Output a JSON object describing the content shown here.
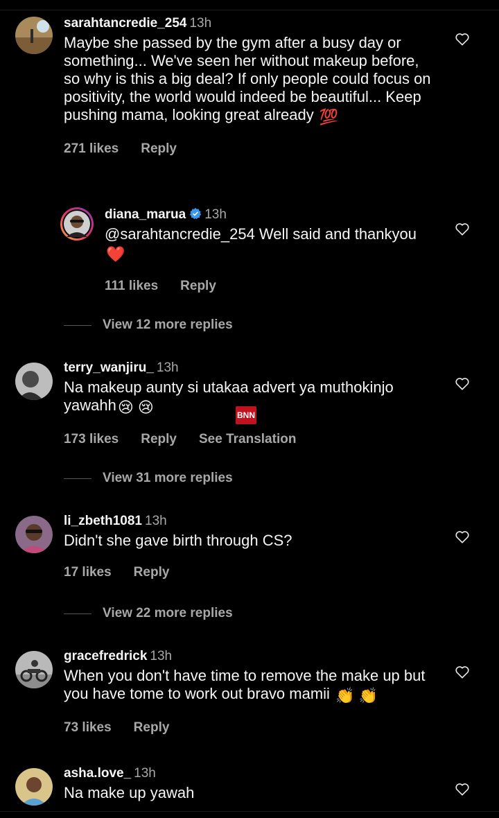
{
  "comments": [
    {
      "username": "sarahtancredie_254",
      "time": "13h",
      "text": "Maybe she passed by the gym after a busy day or something... We've seen her without makeup before, so why is this a big deal? If only people could focus on positivity, the world would indeed be beautiful... Keep pushing mama, looking great already",
      "emoji": "💯",
      "likes": "271 likes",
      "reply_label": "Reply"
    },
    {
      "username": "diana_marua",
      "time": "13h",
      "text": "@sarahtancredie_254 Well said and thankyou",
      "emoji": "❤️",
      "likes": "111 likes",
      "reply_label": "Reply",
      "view_more": "View 12 more replies"
    },
    {
      "username": "terry_wanjiru_",
      "time": "13h",
      "text": "Na makeup aunty si utakaa advert ya muthokinjo yawahh",
      "emoji": "😢 😢",
      "likes": "173 likes",
      "reply_label": "Reply",
      "translation_label": "See Translation",
      "view_more": "View 31 more replies"
    },
    {
      "username": "li_zbeth1081",
      "time": "13h",
      "text": "Didn't she gave birth through CS?",
      "likes": "17 likes",
      "reply_label": "Reply",
      "view_more": "View 22 more replies"
    },
    {
      "username": "gracefredrick",
      "time": "13h",
      "text": "When you don't have time to remove the make up but you have tome to work out bravo mamii",
      "emoji": "👏 👏",
      "likes": "73 likes",
      "reply_label": "Reply"
    },
    {
      "username": "asha.love_",
      "time": "13h",
      "text": "Na make up yawah"
    }
  ],
  "watermark": "BNN",
  "colors": {
    "background": "#000000",
    "text": "#f5f5f5",
    "secondary": "#a8a8a8",
    "verified": "#3897f0",
    "heart_emoji": "#e0245e"
  },
  "icons": {
    "like": "heart-outline-icon",
    "verified": "verified-badge-icon"
  }
}
